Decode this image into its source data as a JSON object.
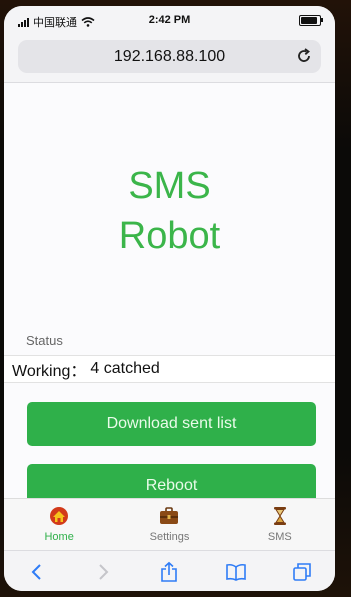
{
  "statusbar": {
    "carrier": "中国联通",
    "time": "2:42 PM"
  },
  "browser": {
    "url": "192.168.88.100"
  },
  "page": {
    "title_line1": "SMS",
    "title_line2": "Robot",
    "status_label": "Status",
    "status_key": "Working：",
    "status_value": "4 catched",
    "buttons": {
      "download": "Download sent list",
      "reboot": "Reboot"
    }
  },
  "tabs": [
    {
      "label": "Home",
      "icon": "home-icon",
      "active": true
    },
    {
      "label": "Settings",
      "icon": "briefcase-icon",
      "active": false
    },
    {
      "label": "SMS",
      "icon": "hourglass-icon",
      "active": false
    }
  ],
  "colors": {
    "accent": "#2fb04a",
    "title": "#3bb54a",
    "safari_blue": "#2f7cf6"
  }
}
